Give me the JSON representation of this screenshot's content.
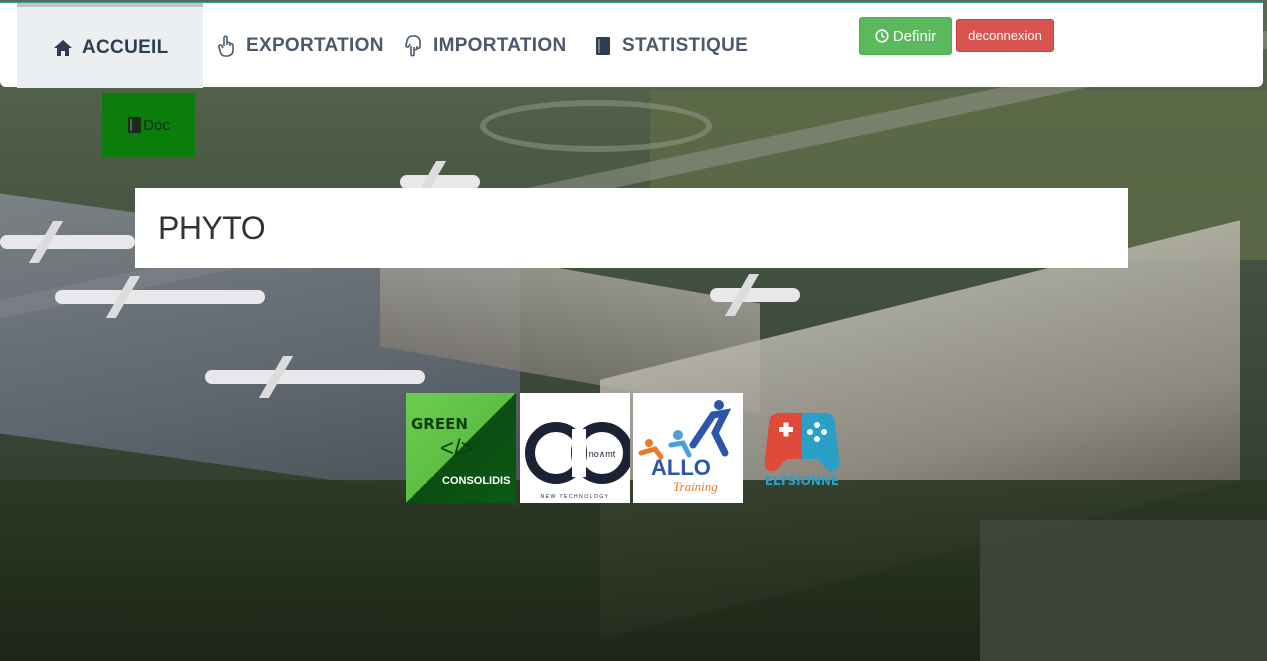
{
  "nav": {
    "items": [
      {
        "label": "ACCUEIL",
        "icon": "home-icon",
        "active": true
      },
      {
        "label": "EXPORTATION",
        "icon": "hand-pointer-up-icon",
        "active": false
      },
      {
        "label": "IMPORTATION",
        "icon": "hand-pointer-down-icon",
        "active": false
      },
      {
        "label": "STATISTIQUE",
        "icon": "book-icon",
        "active": false
      }
    ],
    "define_label": "Definir",
    "define_icon": "clock-icon",
    "logout_label": "deconnexion"
  },
  "doc_button": {
    "label": "Doc",
    "icon": "book-icon"
  },
  "page_title": "PHYTO",
  "logos": {
    "green": {
      "line1": "GREEN",
      "code": "</>",
      "line2": "CONSOLIDIS"
    },
    "nt": {
      "word": "no∧mt",
      "tagline": "NEW TECHNOLOGY"
    },
    "allo": {
      "word": "ALLO",
      "sub": "Training"
    },
    "ely": {
      "word": "ELYSIONNE"
    }
  },
  "colors": {
    "success": "#5cb85c",
    "danger": "#d9534f",
    "doc": "#0a7d0a",
    "nav_text": "#4a5a6a"
  }
}
